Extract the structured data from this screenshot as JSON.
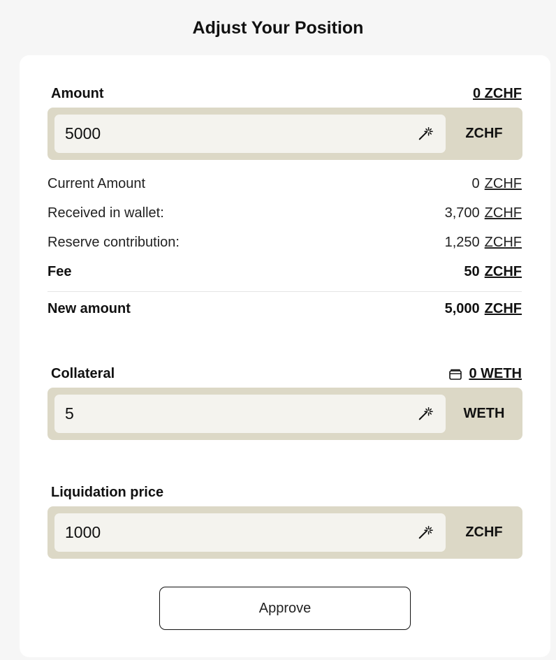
{
  "title": "Adjust Your Position",
  "amount": {
    "label": "Amount",
    "balance": "0 ZCHF",
    "value": "5000",
    "unit": "ZCHF"
  },
  "details": {
    "current_amount": {
      "label": "Current Amount",
      "value": "0",
      "unit": "ZCHF"
    },
    "received": {
      "label": "Received in wallet:",
      "value": "3,700",
      "unit": "ZCHF"
    },
    "reserve": {
      "label": "Reserve contribution:",
      "value": "1,250",
      "unit": "ZCHF"
    },
    "fee": {
      "label": "Fee",
      "value": "50",
      "unit": "ZCHF"
    },
    "new_amount": {
      "label": "New amount",
      "value": "5,000",
      "unit": "ZCHF"
    }
  },
  "collateral": {
    "label": "Collateral",
    "balance": "0 WETH",
    "value": "5",
    "unit": "WETH"
  },
  "liquidation": {
    "label": "Liquidation price",
    "value": "1000",
    "unit": "ZCHF"
  },
  "approve_label": "Approve",
  "icons": {
    "input_action": "magic-wand-icon",
    "wallet": "wallet-icon"
  }
}
